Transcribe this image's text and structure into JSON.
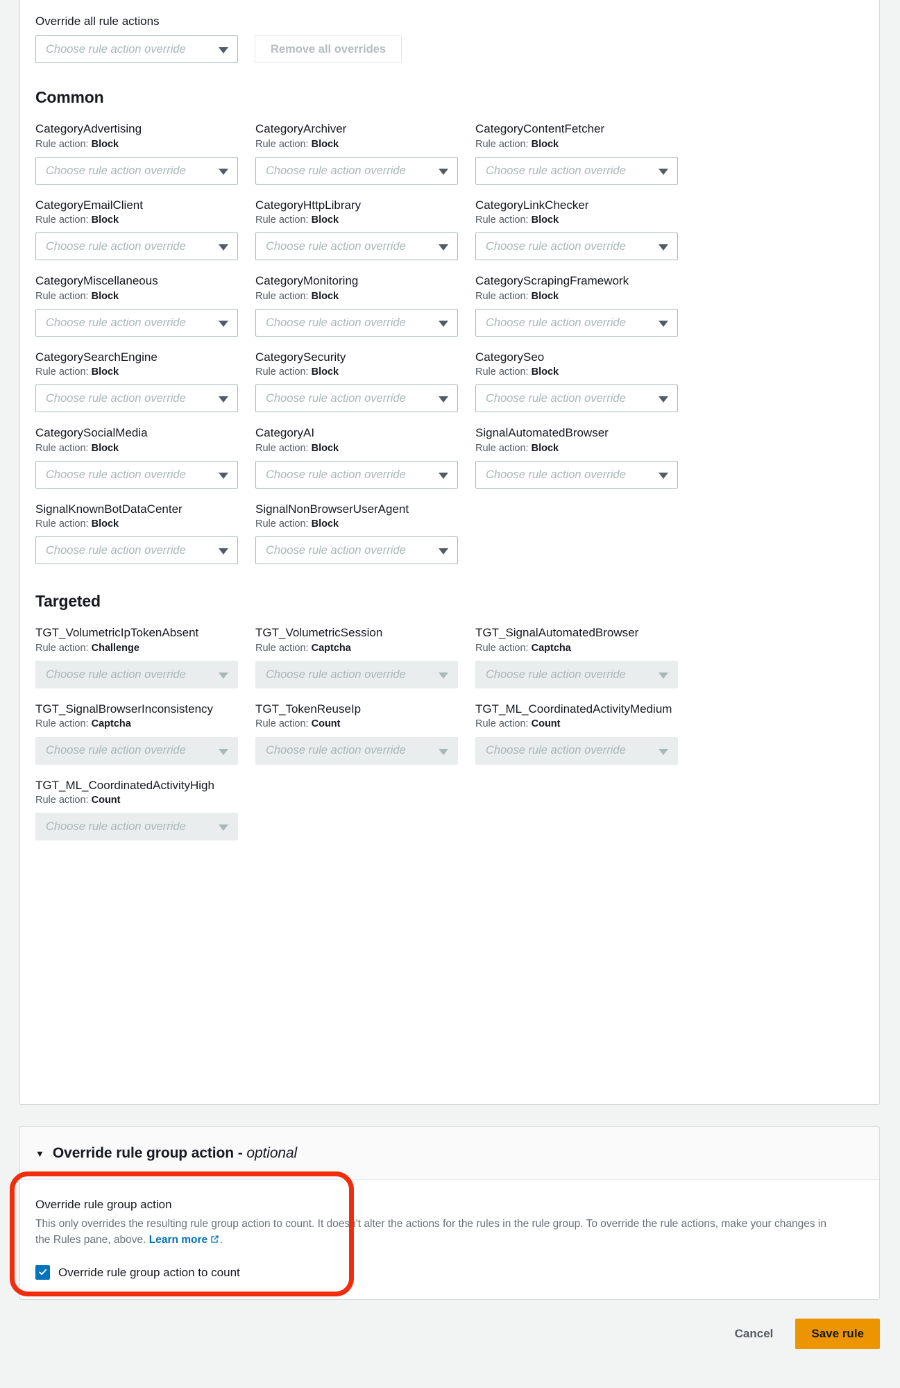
{
  "rules_panel": {
    "override_all": {
      "label": "Override all rule actions",
      "select_placeholder": "Choose rule action override",
      "remove_all_label": "Remove all overrides"
    },
    "sections": [
      {
        "heading": "Common",
        "rules": [
          {
            "name": "CategoryAdvertising",
            "action_prefix": "Rule action:",
            "action": "Block",
            "placeholder": "Choose rule action override",
            "disabled": false
          },
          {
            "name": "CategoryArchiver",
            "action_prefix": "Rule action:",
            "action": "Block",
            "placeholder": "Choose rule action override",
            "disabled": false
          },
          {
            "name": "CategoryContentFetcher",
            "action_prefix": "Rule action:",
            "action": "Block",
            "placeholder": "Choose rule action override",
            "disabled": false
          },
          {
            "name": "CategoryEmailClient",
            "action_prefix": "Rule action:",
            "action": "Block",
            "placeholder": "Choose rule action override",
            "disabled": false
          },
          {
            "name": "CategoryHttpLibrary",
            "action_prefix": "Rule action:",
            "action": "Block",
            "placeholder": "Choose rule action override",
            "disabled": false
          },
          {
            "name": "CategoryLinkChecker",
            "action_prefix": "Rule action:",
            "action": "Block",
            "placeholder": "Choose rule action override",
            "disabled": false
          },
          {
            "name": "CategoryMiscellaneous",
            "action_prefix": "Rule action:",
            "action": "Block",
            "placeholder": "Choose rule action override",
            "disabled": false
          },
          {
            "name": "CategoryMonitoring",
            "action_prefix": "Rule action:",
            "action": "Block",
            "placeholder": "Choose rule action override",
            "disabled": false
          },
          {
            "name": "CategoryScrapingFramework",
            "action_prefix": "Rule action:",
            "action": "Block",
            "placeholder": "Choose rule action override",
            "disabled": false
          },
          {
            "name": "CategorySearchEngine",
            "action_prefix": "Rule action:",
            "action": "Block",
            "placeholder": "Choose rule action override",
            "disabled": false
          },
          {
            "name": "CategorySecurity",
            "action_prefix": "Rule action:",
            "action": "Block",
            "placeholder": "Choose rule action override",
            "disabled": false
          },
          {
            "name": "CategorySeo",
            "action_prefix": "Rule action:",
            "action": "Block",
            "placeholder": "Choose rule action override",
            "disabled": false
          },
          {
            "name": "CategorySocialMedia",
            "action_prefix": "Rule action:",
            "action": "Block",
            "placeholder": "Choose rule action override",
            "disabled": false
          },
          {
            "name": "CategoryAI",
            "action_prefix": "Rule action:",
            "action": "Block",
            "placeholder": "Choose rule action override",
            "disabled": false
          },
          {
            "name": "SignalAutomatedBrowser",
            "action_prefix": "Rule action:",
            "action": "Block",
            "placeholder": "Choose rule action override",
            "disabled": false
          },
          {
            "name": "SignalKnownBotDataCenter",
            "action_prefix": "Rule action:",
            "action": "Block",
            "placeholder": "Choose rule action override",
            "disabled": false
          },
          {
            "name": "SignalNonBrowserUserAgent",
            "action_prefix": "Rule action:",
            "action": "Block",
            "placeholder": "Choose rule action override",
            "disabled": false
          }
        ]
      },
      {
        "heading": "Targeted",
        "rules": [
          {
            "name": "TGT_VolumetricIpTokenAbsent",
            "action_prefix": "Rule action:",
            "action": "Challenge",
            "placeholder": "Choose rule action override",
            "disabled": true
          },
          {
            "name": "TGT_VolumetricSession",
            "action_prefix": "Rule action:",
            "action": "Captcha",
            "placeholder": "Choose rule action override",
            "disabled": true
          },
          {
            "name": "TGT_SignalAutomatedBrowser",
            "action_prefix": "Rule action:",
            "action": "Captcha",
            "placeholder": "Choose rule action override",
            "disabled": true
          },
          {
            "name": "TGT_SignalBrowserInconsistency",
            "action_prefix": "Rule action:",
            "action": "Captcha",
            "placeholder": "Choose rule action override",
            "disabled": true
          },
          {
            "name": "TGT_TokenReuseIp",
            "action_prefix": "Rule action:",
            "action": "Count",
            "placeholder": "Choose rule action override",
            "disabled": true
          },
          {
            "name": "TGT_ML_CoordinatedActivityMedium",
            "action_prefix": "Rule action:",
            "action": "Count",
            "placeholder": "Choose rule action override",
            "disabled": true
          },
          {
            "name": "TGT_ML_CoordinatedActivityHigh",
            "action_prefix": "Rule action:",
            "action": "Count",
            "placeholder": "Choose rule action override",
            "disabled": true
          }
        ]
      }
    ]
  },
  "override_panel": {
    "header_title": "Override rule group action - ",
    "header_optional": "optional",
    "caret": "▼",
    "field_label": "Override rule group action",
    "description_part1": "This only overrides the resulting rule group action to count. It doesn't alter the actions for the rules in the rule group. To override the rule actions, make your changes in the Rules pane, above. ",
    "learn_more": "Learn more",
    "description_part2": ".",
    "checkbox_label": "Override rule group action to count",
    "checkbox_checked": true
  },
  "footer": {
    "cancel_label": "Cancel",
    "save_label": "Save rule"
  },
  "colors": {
    "accent_link": "#0073bb",
    "primary_button": "#ec9500",
    "annotation": "#f22d0c",
    "panel_bg": "#ffffff",
    "page_bg": "#f2f3f3"
  }
}
